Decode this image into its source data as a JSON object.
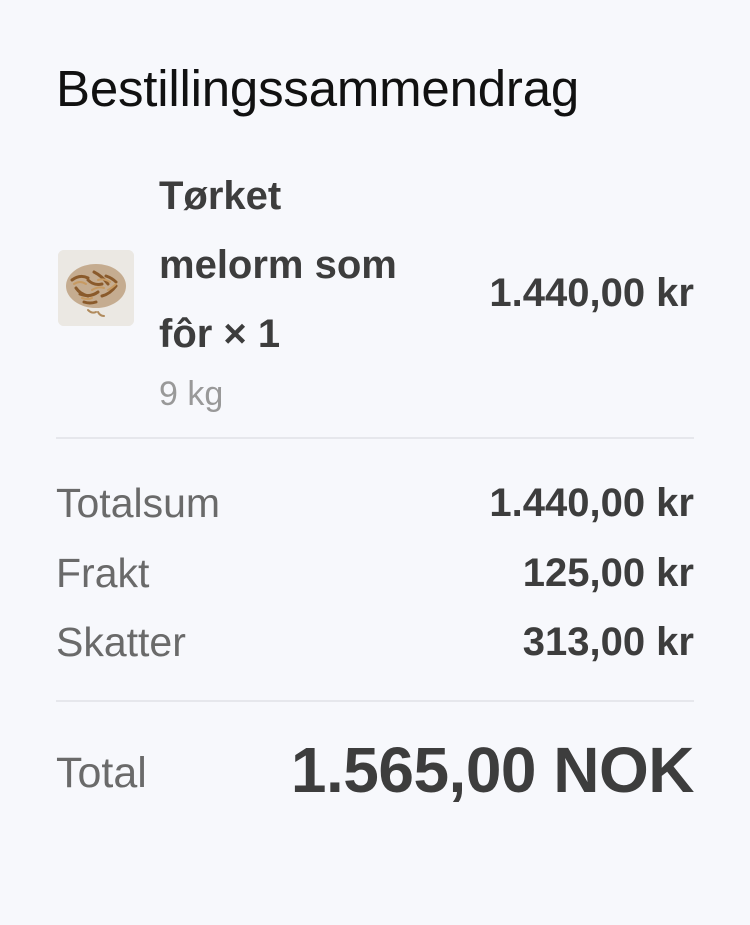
{
  "summary": {
    "title": "Bestillingssammendrag"
  },
  "item": {
    "name": "Tørket melorm som fôr × 1",
    "variant": "9 kg",
    "price": "1.440,00 kr",
    "image_icon": "dried-mealworms-image"
  },
  "totals": {
    "subtotal_label": "Totalsum",
    "subtotal_value": "1.440,00 kr",
    "shipping_label": "Frakt",
    "shipping_value": "125,00 kr",
    "taxes_label": "Skatter",
    "taxes_value": "313,00 kr"
  },
  "grand_total": {
    "label": "Total",
    "value": "1.565,00 NOK"
  },
  "colors": {
    "background": "#f7f8fc",
    "title_text": "#111111",
    "strong_text": "#3d3d3d",
    "muted_text": "#6a6a6a",
    "variant_text": "#999999",
    "divider": "#e6e7ec"
  }
}
